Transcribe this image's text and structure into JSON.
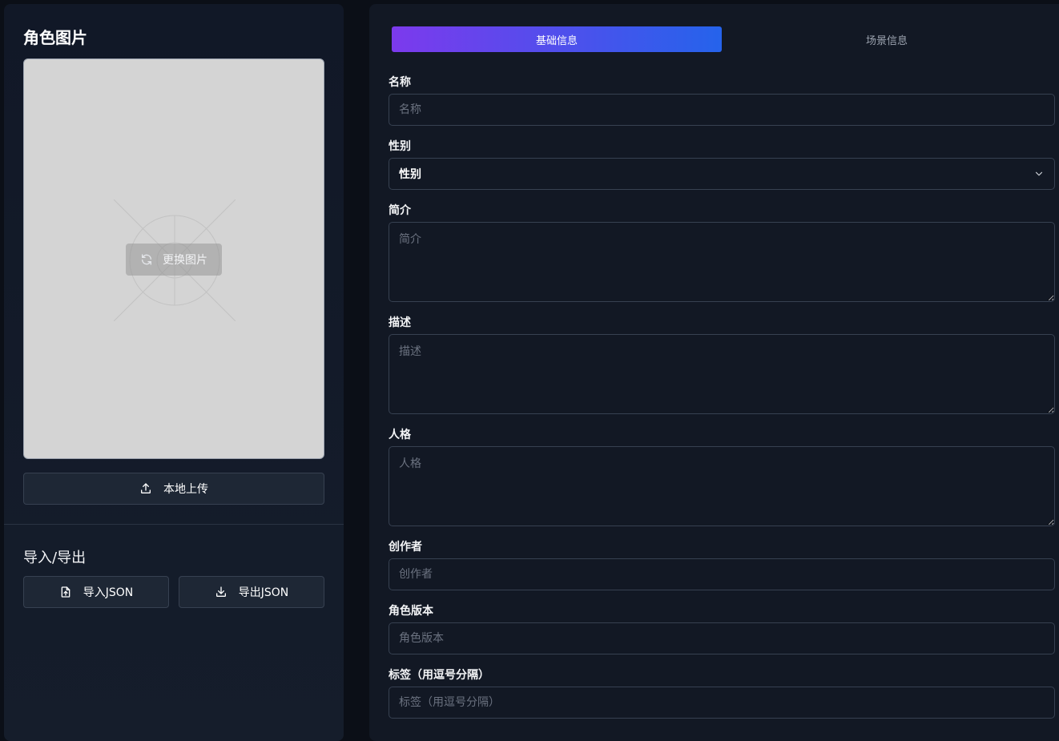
{
  "left": {
    "image_section_title": "角色图片",
    "change_image_label": "更换图片",
    "upload_label": "本地上传",
    "io_section_title": "导入/导出",
    "import_label": "导入JSON",
    "export_label": "导出JSON"
  },
  "tabs": [
    {
      "label": "基础信息",
      "active": true
    },
    {
      "label": "场景信息",
      "active": false
    }
  ],
  "form": {
    "name": {
      "label": "名称",
      "value": "",
      "placeholder": "名称"
    },
    "gender": {
      "label": "性别",
      "value": "性别"
    },
    "summary": {
      "label": "简介",
      "value": "",
      "placeholder": "简介"
    },
    "description": {
      "label": "描述",
      "value": "",
      "placeholder": "描述"
    },
    "personality": {
      "label": "人格",
      "value": "",
      "placeholder": "人格"
    },
    "creator": {
      "label": "创作者",
      "value": "",
      "placeholder": "创作者"
    },
    "version": {
      "label": "角色版本",
      "value": "",
      "placeholder": "角色版本"
    },
    "tags": {
      "label": "标签（用逗号分隔）",
      "value": "",
      "placeholder": "标签（用逗号分隔）"
    }
  },
  "colors": {
    "accent_start": "#7c3aed",
    "accent_end": "#2563eb",
    "panel_bg": "#121824",
    "border": "#374151"
  }
}
